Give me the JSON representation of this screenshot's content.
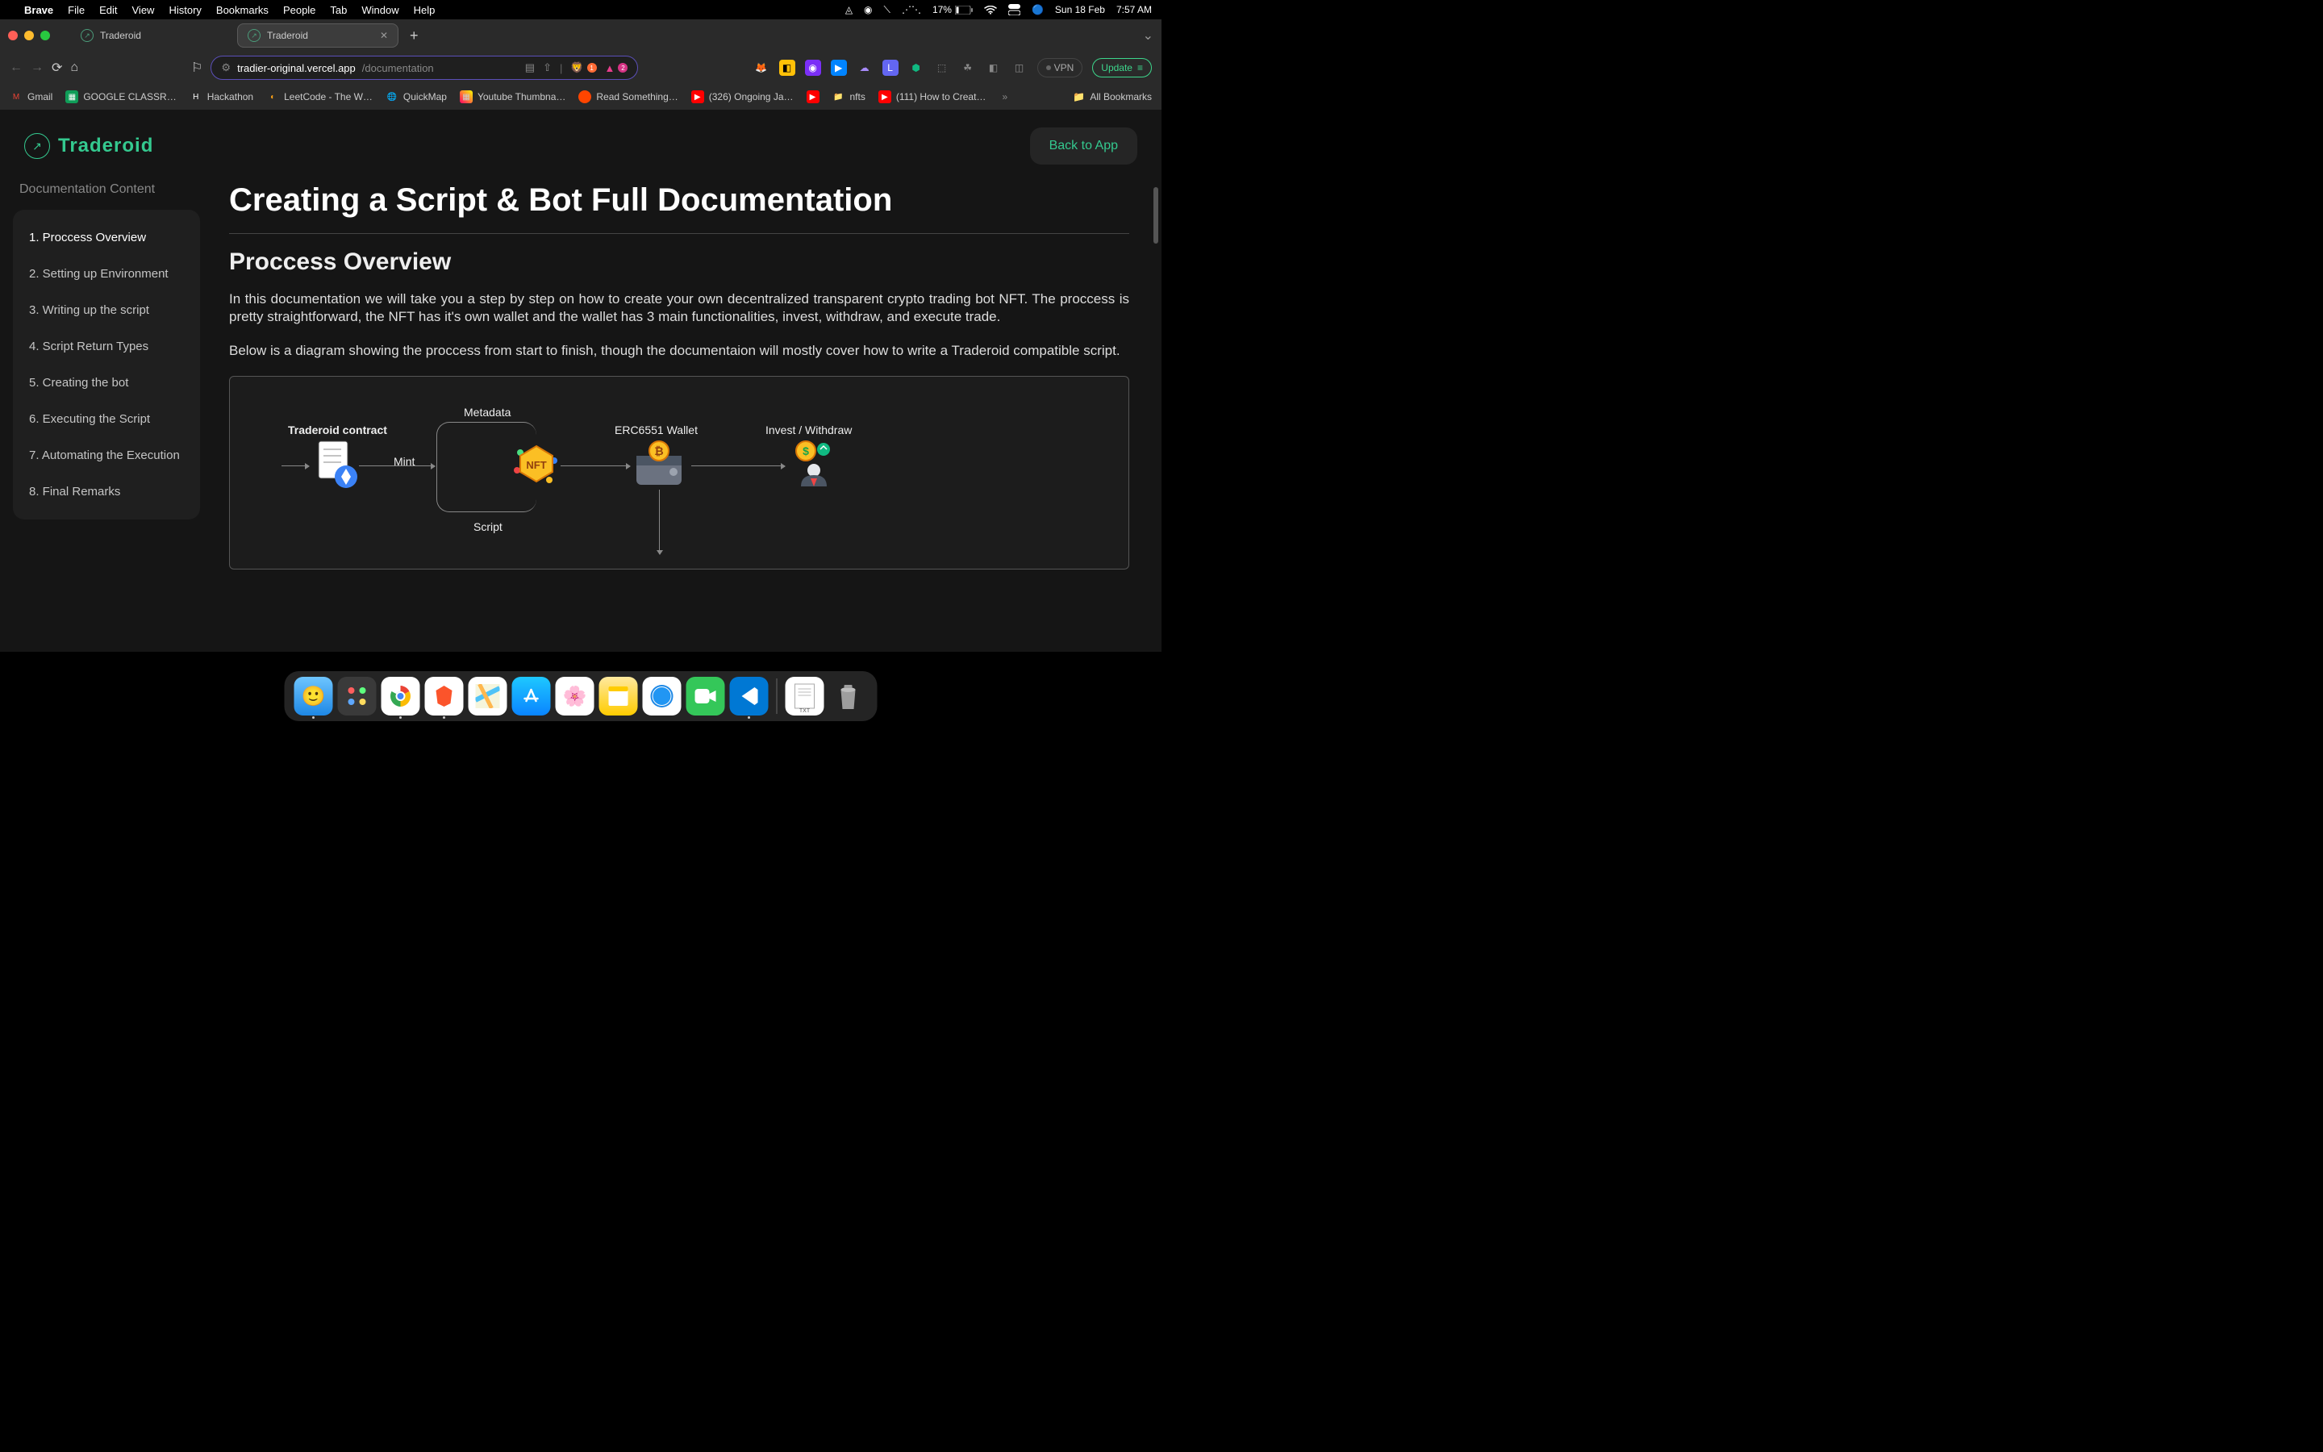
{
  "menubar": {
    "app": "Brave",
    "items": [
      "File",
      "Edit",
      "View",
      "History",
      "Bookmarks",
      "People",
      "Tab",
      "Window",
      "Help"
    ],
    "battery": "17%",
    "date": "Sun 18 Feb",
    "time": "7:57 AM"
  },
  "tabs": {
    "t0": "Traderoid",
    "t1": "Traderoid"
  },
  "address": {
    "domain": "tradier-original.vercel.app",
    "path": "/documentation",
    "shield1_count": "1",
    "shield2_count": "2"
  },
  "toolbar": {
    "vpn": "VPN",
    "update": "Update"
  },
  "bookmarks": {
    "b0": "Gmail",
    "b1": "GOOGLE CLASSR…",
    "b2": "Hackathon",
    "b3": "LeetCode - The W…",
    "b4": "QuickMap",
    "b5": "Youtube Thumbna…",
    "b6": "Read Something…",
    "b7": "(326) Ongoing Ja…",
    "b8": "nfts",
    "b9": "(111) How to Creat…",
    "all": "All Bookmarks"
  },
  "page": {
    "logo": "Traderoid",
    "back": "Back to App",
    "sidebar_title": "Documentation Content",
    "sidebar": {
      "s0": "1. Proccess Overview",
      "s1": "2. Setting up Environment",
      "s2": "3. Writing up the script",
      "s3": "4. Script Return Types",
      "s4": "5. Creating the bot",
      "s5": "6. Executing the Script",
      "s6": "7. Automating the Execution",
      "s7": "8. Final Remarks"
    },
    "h1": "Creating a Script & Bot Full Documentation",
    "h2": "Proccess Overview",
    "p1": "In this documentation we will take you a step by step on how to create your own decentralized transparent crypto trading bot NFT. The proccess is pretty straightforward, the NFT has it's own wallet and the wallet has 3 main functionalities, invest, withdraw, and execute trade.",
    "p2": "Below is a diagram showing the proccess from start to finish, though the documentaion will mostly cover how to write a Traderoid compatible script.",
    "diagram": {
      "contract": "Traderoid contract",
      "mint": "Mint",
      "metadata": "Metadata",
      "script": "Script",
      "wallet": "ERC6551 Wallet",
      "invest": "Invest / Withdraw"
    }
  },
  "dock": {
    "txt": "TXT"
  }
}
